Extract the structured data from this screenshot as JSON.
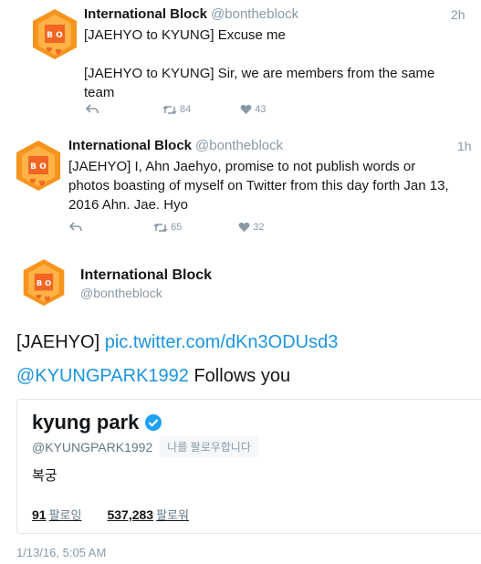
{
  "tweets": [
    {
      "author": "International Block",
      "handle": "@bontheblock",
      "time": "2h",
      "lines": [
        "[JAEHYO to KYUNG] Excuse me",
        "[JAEHYO to KYUNG] Sir, we are members from the same team"
      ],
      "retweets": "84",
      "likes": "43"
    },
    {
      "author": "International Block",
      "handle": "@bontheblock",
      "time": "1h",
      "text": "[JAEHYO] I, Ahn Jaehyo, promise to not publish words or photos boasting of myself on Twitter from this day forth Jan 13, 2016 Ahn. Jae. Hyo",
      "retweets": "65",
      "likes": "32"
    }
  ],
  "main_tweet": {
    "author": "International Block",
    "handle": "@bontheblock",
    "text_prefix": "[JAEHYO]",
    "link": "pic.twitter.com/dKn3ODUsd3",
    "mention": "@KYUNGPARK1992",
    "mention_suffix": "Follows you",
    "timestamp": "1/13/16, 5:05 AM"
  },
  "profile_card": {
    "name": "kyung park",
    "handle": "@KYUNGPARK1992",
    "follows_badge": "나를 팔로우합니다",
    "bio": "복궁",
    "following_count": "91",
    "following_label": "팔로잉",
    "followers_count": "537,283",
    "followers_label": "팔로워"
  },
  "colors": {
    "accent": "#1b95e0",
    "muted": "#8899a6",
    "avatar_orange": "#f7941d",
    "verified": "#1da1f2"
  },
  "icons": [
    "avatar-logo",
    "reply-icon",
    "retweet-icon",
    "heart-icon",
    "verified-badge-icon"
  ]
}
